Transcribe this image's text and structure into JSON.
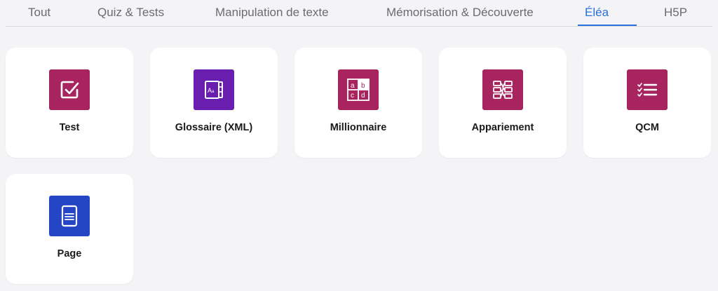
{
  "tabs": [
    {
      "label": "Tout"
    },
    {
      "label": "Quiz & Tests"
    },
    {
      "label": "Manipulation de texte"
    },
    {
      "label": "Mémorisation & Découverte"
    },
    {
      "label": "Éléa"
    },
    {
      "label": "H5P"
    }
  ],
  "active_tab": "Éléa",
  "colors": {
    "accent": "#2a6fdb",
    "magenta": "#a8245e",
    "purple": "#6a1eb0",
    "blue": "#2546c4"
  },
  "cards": [
    {
      "label": "Test",
      "icon": "checkbox-icon"
    },
    {
      "label": "Glossaire (XML)",
      "icon": "glossary-book-icon"
    },
    {
      "label": "Millionnaire",
      "icon": "abcd-grid-icon"
    },
    {
      "label": "Appariement",
      "icon": "matching-icon"
    },
    {
      "label": "QCM",
      "icon": "checklist-icon"
    },
    {
      "label": "Page",
      "icon": "page-document-icon"
    }
  ]
}
